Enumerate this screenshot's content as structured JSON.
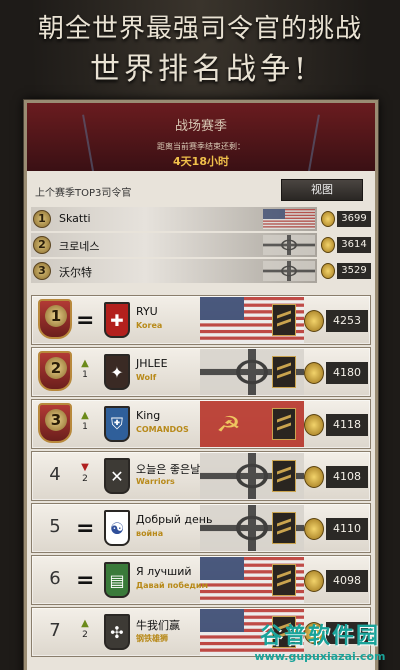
{
  "header": {
    "line1": "朝全世界最强司令官的挑战",
    "line2": "世界排名战争!"
  },
  "season": {
    "title": "战场赛季",
    "subtitle": "距离当前赛季结束还剩：",
    "time_left": "4天18小时"
  },
  "prev_top3": {
    "label": "上个赛季TOP3司令官",
    "view_button": "视图",
    "entries": [
      {
        "rank": "1",
        "name": "Skatti",
        "flag": "us",
        "score": "3699"
      },
      {
        "rank": "2",
        "name": "크로네스",
        "flag": "de",
        "score": "3614"
      },
      {
        "rank": "3",
        "name": "沃尔特",
        "flag": "de",
        "score": "3529"
      }
    ]
  },
  "rankings": [
    {
      "rank": "1",
      "medal": true,
      "change": "=",
      "change_dir": "none",
      "change_num": "",
      "name": "RYU",
      "clan": "Korea",
      "emblem_color": "#b3201d",
      "emblem_icon": "✚",
      "flag": "us",
      "score": "4253"
    },
    {
      "rank": "2",
      "medal": true,
      "change": "",
      "change_dir": "up",
      "change_num": "1",
      "name": "JHLEE",
      "clan": "Wolf",
      "emblem_color": "#3a2a24",
      "emblem_icon": "✦",
      "flag": "de",
      "score": "4180"
    },
    {
      "rank": "3",
      "medal": true,
      "change": "",
      "change_dir": "up",
      "change_num": "1",
      "name": "King",
      "clan": "COMANDOS",
      "emblem_color": "#2f5f9a",
      "emblem_icon": "⛨",
      "flag": "su",
      "score": "4118"
    },
    {
      "rank": "4",
      "medal": false,
      "change": "",
      "change_dir": "down",
      "change_num": "2",
      "name": "오늘은 좋은날",
      "clan": "Warriors",
      "emblem_color": "#3d3a35",
      "emblem_icon": "✕",
      "flag": "de",
      "score": "4108"
    },
    {
      "rank": "5",
      "medal": false,
      "change": "=",
      "change_dir": "none",
      "change_num": "",
      "name": "Добрый день",
      "clan": "война",
      "emblem_color": "#ffffff",
      "emblem_icon": "☯",
      "flag": "de",
      "score": "4110"
    },
    {
      "rank": "6",
      "medal": false,
      "change": "=",
      "change_dir": "none",
      "change_num": "",
      "name": "Я лучший",
      "clan": "Давай победим",
      "emblem_color": "#3a7a3a",
      "emblem_icon": "▤",
      "flag": "us",
      "score": "4098"
    },
    {
      "rank": "7",
      "medal": false,
      "change": "",
      "change_dir": "up",
      "change_num": "2",
      "name": "牛我们赢",
      "clan": "钢铁雄狮",
      "emblem_color": "#3d3a35",
      "emblem_icon": "✣",
      "flag": "us",
      "score": ""
    }
  ],
  "watermark": {
    "cn": "谷普软件园",
    "url": "www.gupuxiazai.com"
  }
}
